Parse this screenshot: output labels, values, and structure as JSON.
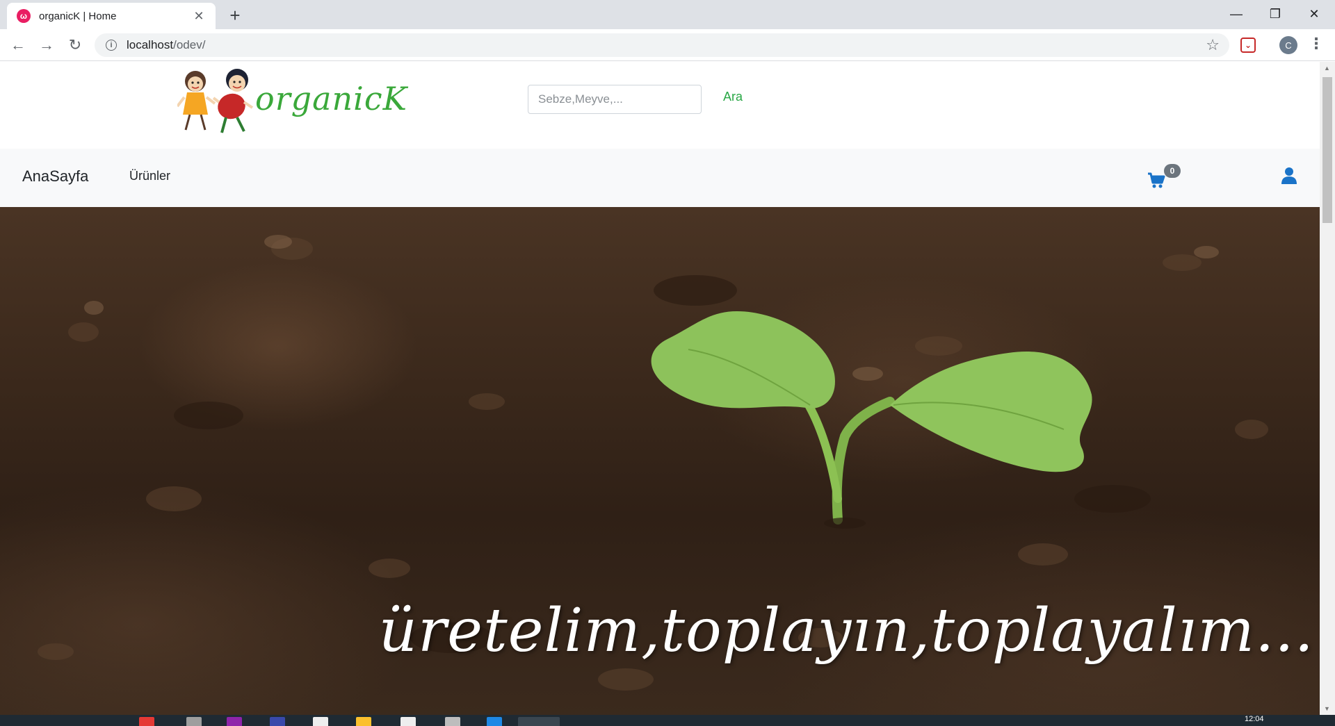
{
  "browser": {
    "tab_title": "organicK | Home",
    "tab_close": "✕",
    "new_tab": "+",
    "url_host": "localhost",
    "url_path": "/odev/",
    "profile_initial": "C",
    "window_controls": {
      "minimize": "—",
      "maximize": "❐",
      "close": "✕"
    },
    "nav_icons": {
      "back": "←",
      "forward": "→",
      "reload": "↻",
      "star": "☆",
      "menu": "⋮"
    }
  },
  "header": {
    "logo_text": "organicK",
    "search": {
      "placeholder": "Sebze,Meyve,...",
      "value": ""
    },
    "search_button": "Ara"
  },
  "navbar": {
    "brand": "AnaSayfa",
    "links": [
      "Ürünler"
    ],
    "cart_count": "0"
  },
  "hero": {
    "caption": "üretelim,toplayın,toplayalım..."
  },
  "taskbar": {
    "clock": "12:04"
  },
  "colors": {
    "accent_green": "#28a745",
    "icon_blue": "#1a73c8",
    "badge_gray": "#6c757d",
    "navbar_bg": "#f8f9fa"
  }
}
